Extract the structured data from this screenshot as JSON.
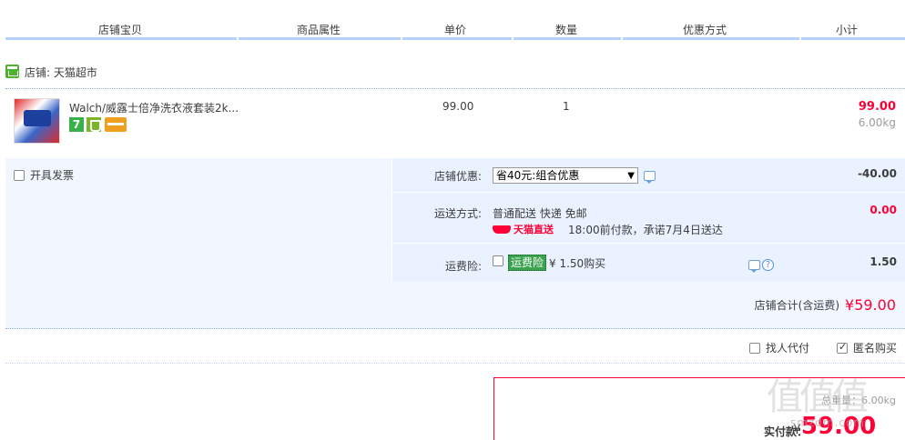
{
  "header": {
    "col_shop_item": "店铺宝贝",
    "col_attributes": "商品属性",
    "col_unit_price": "单价",
    "col_quantity": "数量",
    "col_discount": "优惠方式",
    "col_subtotal": "小计"
  },
  "shop": {
    "label": "店铺: 天猫超市"
  },
  "item": {
    "title": "Walch/威露士倍净洗衣液套装2k...",
    "badge_seven": "7",
    "price": "99.00",
    "quantity": "1",
    "subtotal": "99.00",
    "weight": "6.00kg"
  },
  "invoice": {
    "label": "开具发票"
  },
  "store_discount": {
    "label": "店铺优惠:",
    "selected": "省40元:组合优惠",
    "amount": "-40.00"
  },
  "shipping": {
    "label": "运送方式:",
    "method": "普通配送 快递 免邮",
    "logo_text": "天猫直送",
    "promise": "18:00前付款，承诺7月4日送达",
    "amount": "0.00"
  },
  "insurance": {
    "label": "运费险:",
    "tag": "运费险",
    "price": "¥ 1.50购买",
    "amount": "1.50"
  },
  "store_total": {
    "label": "店铺合计(含运费)",
    "amount": "¥59.00"
  },
  "pay_options": {
    "proxy_pay": "找人代付",
    "anonymous": "匿名购买"
  },
  "summary": {
    "total_weight": "总重量：6.00kg",
    "pay_label": "实付款：",
    "currency": "¥",
    "pay_amount": "59.00"
  },
  "watermark": {
    "text": "值值值",
    "url": "smzdm.com"
  },
  "colors": {
    "accent_red": "#ff0036",
    "header_line": "#b2d1ff",
    "panel_bg": "#f2f7ff"
  }
}
